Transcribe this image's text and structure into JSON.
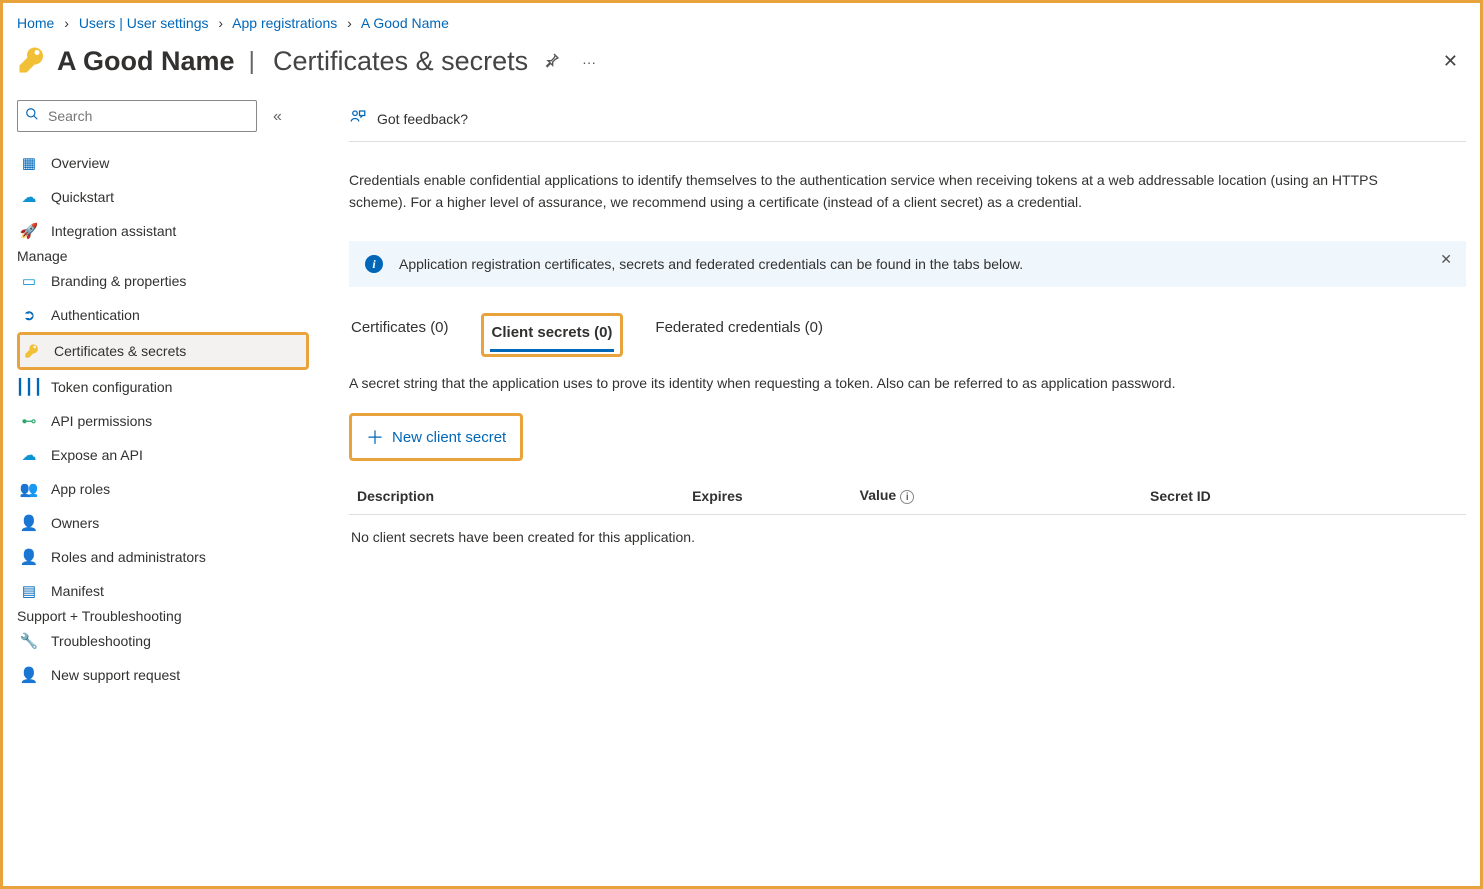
{
  "breadcrumb": {
    "items": [
      "Home",
      "Users | User settings",
      "App registrations",
      "A Good Name"
    ]
  },
  "header": {
    "title": "A Good Name",
    "subtitle": "Certificates & secrets"
  },
  "search": {
    "placeholder": "Search"
  },
  "sidebar": {
    "top": [
      {
        "label": "Overview",
        "icon": "grid",
        "color": "#0067b8"
      },
      {
        "label": "Quickstart",
        "icon": "cloud",
        "color": "#0d93d1"
      },
      {
        "label": "Integration assistant",
        "icon": "rocket",
        "color": "#e67e22"
      }
    ],
    "manage_heading": "Manage",
    "manage": [
      {
        "label": "Branding & properties",
        "icon": "card",
        "color": "#0d93d1"
      },
      {
        "label": "Authentication",
        "icon": "auth",
        "color": "#0067b8"
      },
      {
        "label": "Certificates & secrets",
        "icon": "key",
        "color": "#f2c037",
        "active": true,
        "highlight": true
      },
      {
        "label": "Token configuration",
        "icon": "bars",
        "color": "#0067b8"
      },
      {
        "label": "API permissions",
        "icon": "perm",
        "color": "#2aa86b"
      },
      {
        "label": "Expose an API",
        "icon": "cloudapi",
        "color": "#0d93d1"
      },
      {
        "label": "App roles",
        "icon": "roles",
        "color": "#0067b8"
      },
      {
        "label": "Owners",
        "icon": "owners",
        "color": "#0067b8"
      },
      {
        "label": "Roles and administrators",
        "icon": "admin",
        "color": "#2aa86b"
      },
      {
        "label": "Manifest",
        "icon": "manifest",
        "color": "#0067b8"
      }
    ],
    "support_heading": "Support + Troubleshooting",
    "support": [
      {
        "label": "Troubleshooting",
        "icon": "wrench",
        "color": "#555"
      },
      {
        "label": "New support request",
        "icon": "support",
        "color": "#0d93d1"
      }
    ]
  },
  "toolbar": {
    "feedback": "Got feedback?"
  },
  "intro": "Credentials enable confidential applications to identify themselves to the authentication service when receiving tokens at a web addressable location (using an HTTPS scheme). For a higher level of assurance, we recommend using a certificate (instead of a client secret) as a credential.",
  "banner": "Application registration certificates, secrets and federated credentials can be found in the tabs below.",
  "tabs": [
    {
      "label": "Certificates (0)"
    },
    {
      "label": "Client secrets (0)",
      "active": true,
      "highlight": true
    },
    {
      "label": "Federated credentials (0)"
    }
  ],
  "tab_desc": "A secret string that the application uses to prove its identity when requesting a token. Also can be referred to as application password.",
  "new_btn": "New client secret",
  "table": {
    "columns": [
      "Description",
      "Expires",
      "Value",
      "Secret ID"
    ]
  },
  "empty": "No client secrets have been created for this application."
}
